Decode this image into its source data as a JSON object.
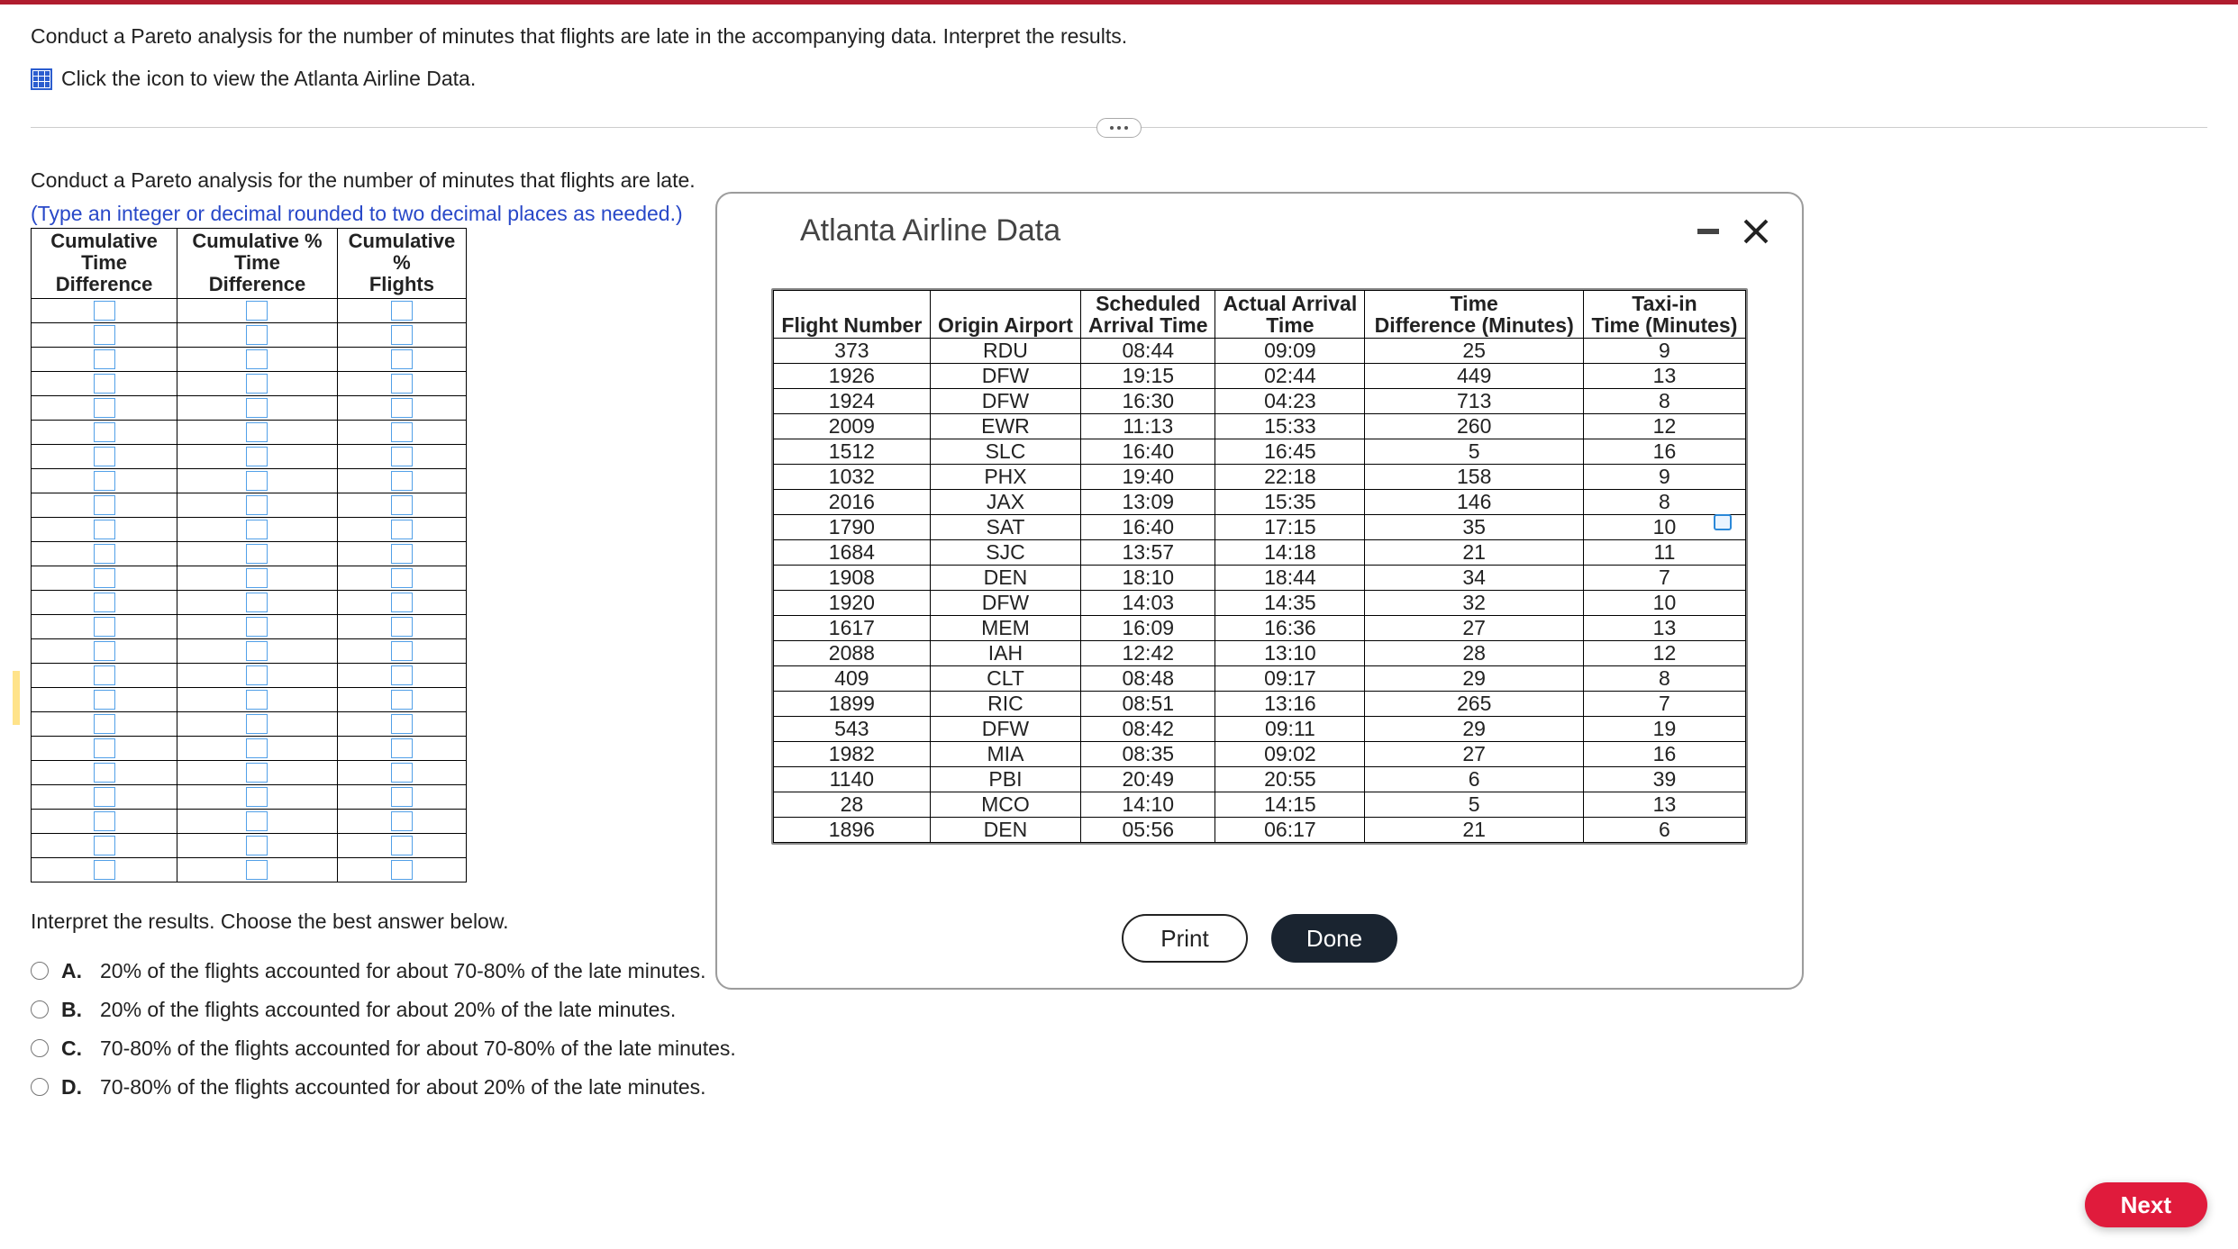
{
  "prompt1": "Conduct a Pareto analysis for the number of minutes that flights are late in the accompanying data. Interpret the results.",
  "icon_link_text": "Click the icon to view the Atlanta Airline Data.",
  "prompt2": "Conduct a Pareto analysis for the number of minutes that flights are late.",
  "hint": "(Type an integer or decimal rounded to two decimal places as needed.)",
  "input_headers": {
    "col1a": "Cumulative Time",
    "col1b": "Difference",
    "col2a": "Cumulative % Time",
    "col2b": "Difference",
    "col3a": "Cumulative %",
    "col3b": "Flights"
  },
  "input_rows": 24,
  "interpret_label": "Interpret the results. Choose the best answer below.",
  "choices": [
    {
      "label": "A.",
      "text": "20% of the flights accounted for about 70-80% of the late minutes."
    },
    {
      "label": "B.",
      "text": "20% of the flights accounted for about 20% of the late minutes."
    },
    {
      "label": "C.",
      "text": "70-80% of the flights accounted for about 70-80% of the late minutes."
    },
    {
      "label": "D.",
      "text": "70-80% of the flights accounted for about 20% of the late minutes."
    }
  ],
  "modal": {
    "title": "Atlanta Airline Data",
    "headers": [
      "Flight Number",
      "Origin Airport",
      "Scheduled Arrival Time",
      "Actual Arrival Time",
      "Time Difference (Minutes)",
      "Taxi-in Time (Minutes)"
    ],
    "rows": [
      [
        "373",
        "RDU",
        "08:44",
        "09:09",
        "25",
        "9"
      ],
      [
        "1926",
        "DFW",
        "19:15",
        "02:44",
        "449",
        "13"
      ],
      [
        "1924",
        "DFW",
        "16:30",
        "04:23",
        "713",
        "8"
      ],
      [
        "2009",
        "EWR",
        "11:13",
        "15:33",
        "260",
        "12"
      ],
      [
        "1512",
        "SLC",
        "16:40",
        "16:45",
        "5",
        "16"
      ],
      [
        "1032",
        "PHX",
        "19:40",
        "22:18",
        "158",
        "9"
      ],
      [
        "2016",
        "JAX",
        "13:09",
        "15:35",
        "146",
        "8"
      ],
      [
        "1790",
        "SAT",
        "16:40",
        "17:15",
        "35",
        "10"
      ],
      [
        "1684",
        "SJC",
        "13:57",
        "14:18",
        "21",
        "11"
      ],
      [
        "1908",
        "DEN",
        "18:10",
        "18:44",
        "34",
        "7"
      ],
      [
        "1920",
        "DFW",
        "14:03",
        "14:35",
        "32",
        "10"
      ],
      [
        "1617",
        "MEM",
        "16:09",
        "16:36",
        "27",
        "13"
      ],
      [
        "2088",
        "IAH",
        "12:42",
        "13:10",
        "28",
        "12"
      ],
      [
        "409",
        "CLT",
        "08:48",
        "09:17",
        "29",
        "8"
      ],
      [
        "1899",
        "RIC",
        "08:51",
        "13:16",
        "265",
        "7"
      ],
      [
        "543",
        "DFW",
        "08:42",
        "09:11",
        "29",
        "19"
      ],
      [
        "1982",
        "MIA",
        "08:35",
        "09:02",
        "27",
        "16"
      ],
      [
        "1140",
        "PBI",
        "20:49",
        "20:55",
        "6",
        "39"
      ],
      [
        "28",
        "MCO",
        "14:10",
        "14:15",
        "5",
        "13"
      ],
      [
        "1896",
        "DEN",
        "05:56",
        "06:17",
        "21",
        "6"
      ]
    ],
    "print_label": "Print",
    "done_label": "Done"
  },
  "next_label": "Next",
  "chart_data": {
    "type": "table",
    "title": "Atlanta Airline Data",
    "columns": [
      "Flight Number",
      "Origin Airport",
      "Scheduled Arrival Time",
      "Actual Arrival Time",
      "Time Difference (Minutes)",
      "Taxi-in Time (Minutes)"
    ],
    "rows": [
      [
        373,
        "RDU",
        "08:44",
        "09:09",
        25,
        9
      ],
      [
        1926,
        "DFW",
        "19:15",
        "02:44",
        449,
        13
      ],
      [
        1924,
        "DFW",
        "16:30",
        "04:23",
        713,
        8
      ],
      [
        2009,
        "EWR",
        "11:13",
        "15:33",
        260,
        12
      ],
      [
        1512,
        "SLC",
        "16:40",
        "16:45",
        5,
        16
      ],
      [
        1032,
        "PHX",
        "19:40",
        "22:18",
        158,
        9
      ],
      [
        2016,
        "JAX",
        "13:09",
        "15:35",
        146,
        8
      ],
      [
        1790,
        "SAT",
        "16:40",
        "17:15",
        35,
        10
      ],
      [
        1684,
        "SJC",
        "13:57",
        "14:18",
        21,
        11
      ],
      [
        1908,
        "DEN",
        "18:10",
        "18:44",
        34,
        7
      ],
      [
        1920,
        "DFW",
        "14:03",
        "14:35",
        32,
        10
      ],
      [
        1617,
        "MEM",
        "16:09",
        "16:36",
        27,
        13
      ],
      [
        2088,
        "IAH",
        "12:42",
        "13:10",
        28,
        12
      ],
      [
        409,
        "CLT",
        "08:48",
        "09:17",
        29,
        8
      ],
      [
        1899,
        "RIC",
        "08:51",
        "13:16",
        265,
        7
      ],
      [
        543,
        "DFW",
        "08:42",
        "09:11",
        29,
        19
      ],
      [
        1982,
        "MIA",
        "08:35",
        "09:02",
        27,
        16
      ],
      [
        1140,
        "PBI",
        "20:49",
        "20:55",
        6,
        39
      ],
      [
        28,
        "MCO",
        "14:10",
        "14:15",
        5,
        13
      ],
      [
        1896,
        "DEN",
        "05:56",
        "06:17",
        21,
        6
      ]
    ]
  }
}
